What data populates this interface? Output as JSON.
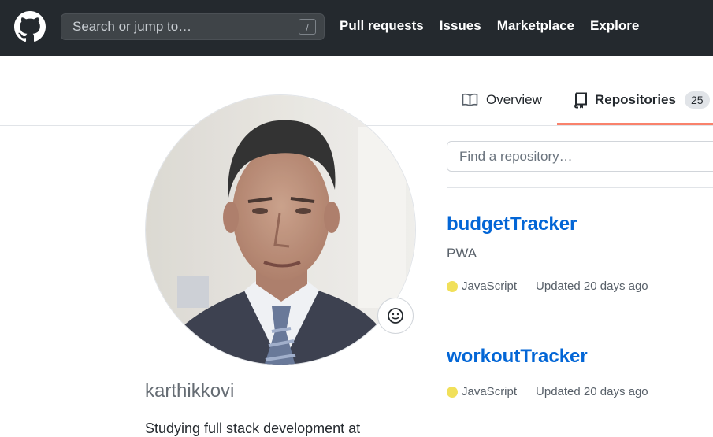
{
  "header": {
    "search_placeholder": "Search or jump to…",
    "search_shortcut": "/",
    "nav": [
      "Pull requests",
      "Issues",
      "Marketplace",
      "Explore"
    ]
  },
  "tabs": {
    "overview": "Overview",
    "repositories": "Repositories",
    "repositories_count": "25"
  },
  "profile": {
    "username": "karthikkovi",
    "bio": "Studying full stack development at"
  },
  "repos": {
    "find_placeholder": "Find a repository…",
    "items": [
      {
        "name": "budgetTracker",
        "description": "PWA",
        "language": "JavaScript",
        "updated": "Updated 20 days ago"
      },
      {
        "name": "workoutTracker",
        "description": "",
        "language": "JavaScript",
        "updated": "Updated 20 days ago"
      }
    ]
  },
  "colors": {
    "header_bg": "#24292e",
    "link_blue": "#0366d6",
    "tab_accent": "#f9826c",
    "javascript": "#f1e05a"
  },
  "icons": [
    "github-logo-icon",
    "book-icon",
    "repo-icon",
    "smiley-icon"
  ]
}
